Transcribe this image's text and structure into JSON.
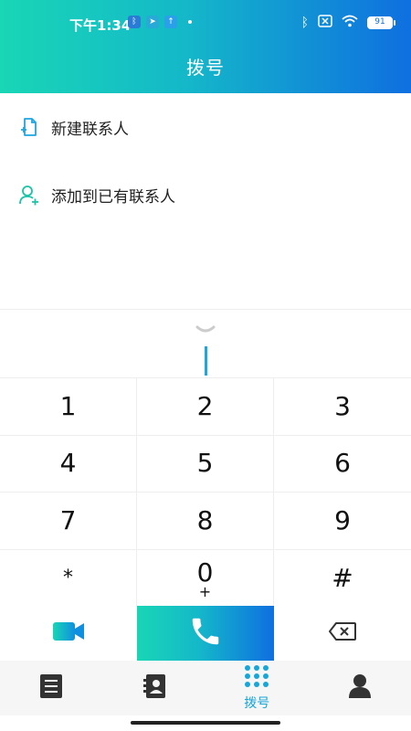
{
  "status": {
    "time": "下午1:34",
    "battery": "91",
    "icons_left": [
      "bluetooth-app-icon",
      "telegram-app-icon",
      "upload-app-icon",
      "dot"
    ],
    "icons_right": [
      "bluetooth-icon",
      "no-sim-icon",
      "wifi-icon",
      "battery-icon"
    ]
  },
  "header": {
    "title": "拨号"
  },
  "menu": {
    "items": [
      {
        "label": "新建联系人",
        "icon": "new-contact-icon"
      },
      {
        "label": "添加到已有联系人",
        "icon": "add-contact-icon"
      }
    ]
  },
  "keypad": {
    "rows": [
      [
        {
          "digit": "1",
          "sub": ""
        },
        {
          "digit": "2",
          "sub": ""
        },
        {
          "digit": "3",
          "sub": ""
        }
      ],
      [
        {
          "digit": "4",
          "sub": ""
        },
        {
          "digit": "5",
          "sub": ""
        },
        {
          "digit": "6",
          "sub": ""
        }
      ],
      [
        {
          "digit": "7",
          "sub": ""
        },
        {
          "digit": "8",
          "sub": ""
        },
        {
          "digit": "9",
          "sub": ""
        }
      ],
      [
        {
          "digit": "*",
          "sub": ""
        },
        {
          "digit": "0",
          "sub": "+"
        },
        {
          "digit": "#",
          "sub": ""
        }
      ]
    ]
  },
  "actions": {
    "video": "video-call-icon",
    "call": "phone-icon",
    "delete": "backspace-icon"
  },
  "tabs": [
    {
      "name": "call-log",
      "icon": "list-icon",
      "label": ""
    },
    {
      "name": "contacts",
      "icon": "contacts-book-icon",
      "label": ""
    },
    {
      "name": "dialpad",
      "icon": "dialpad-icon",
      "label": "拨号"
    },
    {
      "name": "profile",
      "icon": "person-icon",
      "label": ""
    }
  ],
  "colors": {
    "gradient_start": "#19d6b5",
    "gradient_end": "#0f6fe0",
    "accent": "#16a6d8",
    "tab_bar_bg": "#f6f6f6"
  }
}
